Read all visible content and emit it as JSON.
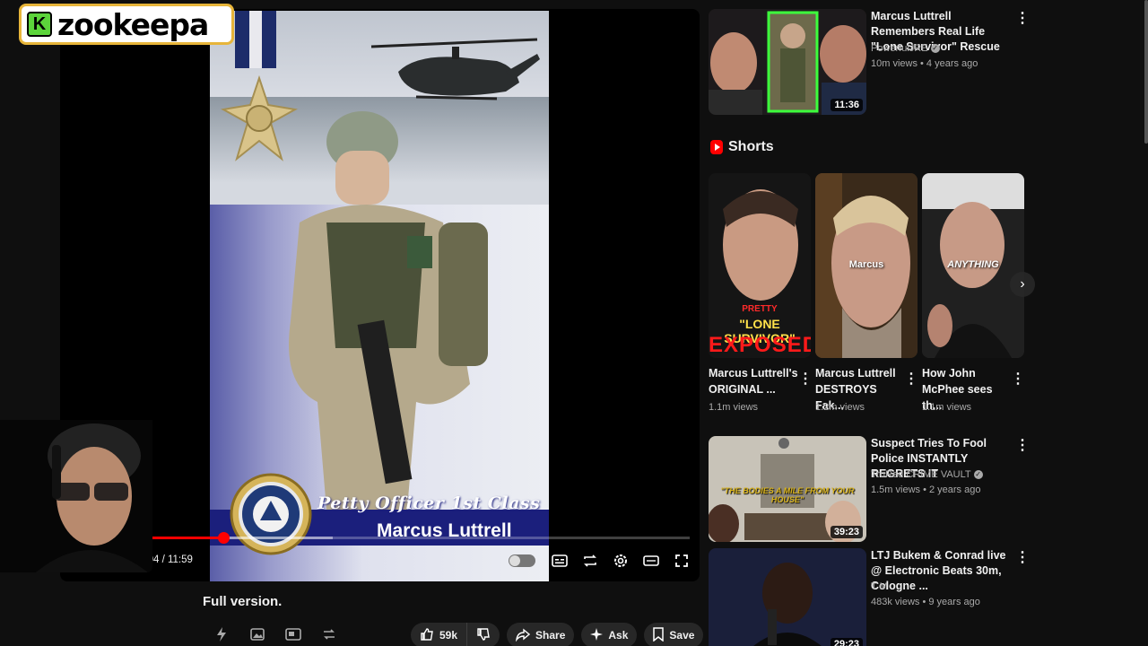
{
  "channel_logo": {
    "letter": "K",
    "text": "zookeepa"
  },
  "player": {
    "overlay_rank": "Petty Officer 1st Class",
    "overlay_name": "Marcus Luttrell",
    "time": "3:04 / 11:59",
    "progress_fraction": 0.15,
    "buffered_fraction": 0.35,
    "controls": [
      "autoplay-toggle",
      "subtitles-icon",
      "loop-icon",
      "settings-icon",
      "theater-icon",
      "fullscreen-icon"
    ]
  },
  "description": {
    "text": "Full version."
  },
  "actions": {
    "like_count": "59k",
    "share_label": "Share",
    "ask_label": "Ask",
    "save_label": "Save"
  },
  "sidebar": {
    "recommended": [
      {
        "title": "Marcus Luttrell Remembers Real Life \"Lone Survivor\" Rescue",
        "channel": "PowerfulJRE",
        "verified": true,
        "meta": "10m views • 4 years ago",
        "duration": "11:36"
      },
      {
        "title": "Suspect Tries To Fool Police INSTANTLY REGRETS IT",
        "channel": "TruRed CRIME VAULT",
        "verified": true,
        "meta": "1.5m views • 2 years ago",
        "duration": "39:23",
        "thumb_caption": "\"THE BODIES A MILE FROM YOUR HOUSE\""
      },
      {
        "title": "LTJ Bukem & Conrad live @ Electronic Beats 30m, Cologne ...",
        "channel": "T M",
        "verified": false,
        "meta": "483k views • 9 years ago",
        "duration": "29:23"
      }
    ],
    "shorts_heading": "Shorts",
    "shorts": [
      {
        "title": "Marcus Luttrell's ORIGINAL ...",
        "views": "1.1m views",
        "caption_top": "PRETTY",
        "caption_mid": "\"LONE SURVIVOR\"",
        "caption_bottom": "EXPOSED"
      },
      {
        "title": "Marcus Luttrell DESTROYS Fak...",
        "views": "1.2m views",
        "caption_mid": "Marcus"
      },
      {
        "title": "How John McPhee sees th...",
        "views": "1.1m views",
        "caption_mid": "ANYTHING"
      }
    ]
  }
}
